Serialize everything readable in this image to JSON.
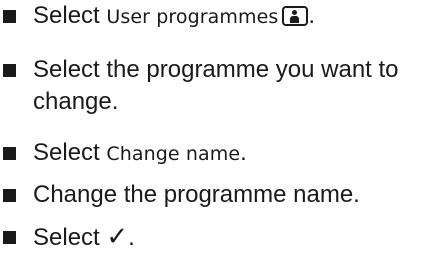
{
  "steps": [
    {
      "prefix": "Select",
      "term": "User programmes",
      "icon": "user-icon",
      "suffix": "."
    },
    {
      "line1": "Select the programme you want to",
      "line2": "change."
    },
    {
      "prefix": "Select",
      "term": "Change name",
      "suffix": "."
    },
    {
      "text": "Change the programme name."
    },
    {
      "prefix": "Select",
      "symbol": "✓",
      "symbol_name": "checkmark-icon",
      "suffix": "."
    }
  ]
}
